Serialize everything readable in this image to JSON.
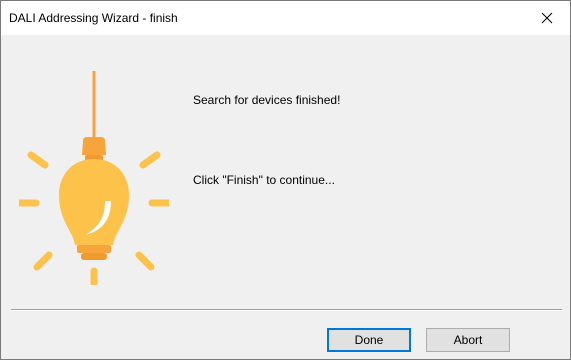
{
  "window": {
    "title": "DALI Addressing Wizard - finish"
  },
  "content": {
    "message_search": "Search for devices finished!",
    "message_continue": "Click \"Finish\" to continue..."
  },
  "buttons": {
    "done_label": "Done",
    "abort_label": "Abort"
  },
  "icons": {
    "close": "close-icon",
    "illustration": "light-bulb-icon"
  },
  "colors": {
    "bulb_orange": "#f7a43b",
    "bulb_yellow": "#fcc24a",
    "rays": "#fcc24a",
    "focus_border": "#0078d7"
  }
}
